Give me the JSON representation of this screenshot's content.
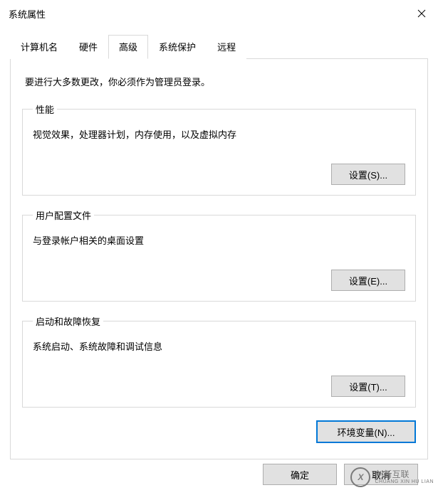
{
  "window": {
    "title": "系统属性"
  },
  "tabs": {
    "computer_name": "计算机名",
    "hardware": "硬件",
    "advanced": "高级",
    "system_protection": "系统保护",
    "remote": "远程"
  },
  "advanced_tab": {
    "intro": "要进行大多数更改，你必须作为管理员登录。",
    "performance": {
      "legend": "性能",
      "desc": "视觉效果，处理器计划，内存使用，以及虚拟内存",
      "settings_btn": "设置(S)..."
    },
    "user_profiles": {
      "legend": "用户配置文件",
      "desc": "与登录帐户相关的桌面设置",
      "settings_btn": "设置(E)..."
    },
    "startup_recovery": {
      "legend": "启动和故障恢复",
      "desc": "系统启动、系统故障和调试信息",
      "settings_btn": "设置(T)..."
    },
    "env_var_btn": "环境变量(N)..."
  },
  "dialog_buttons": {
    "ok": "确定",
    "cancel": "取消"
  },
  "watermark": {
    "glyph": "X",
    "main": "创新互联",
    "sub": "CHUANG XIN HU LIAN"
  }
}
